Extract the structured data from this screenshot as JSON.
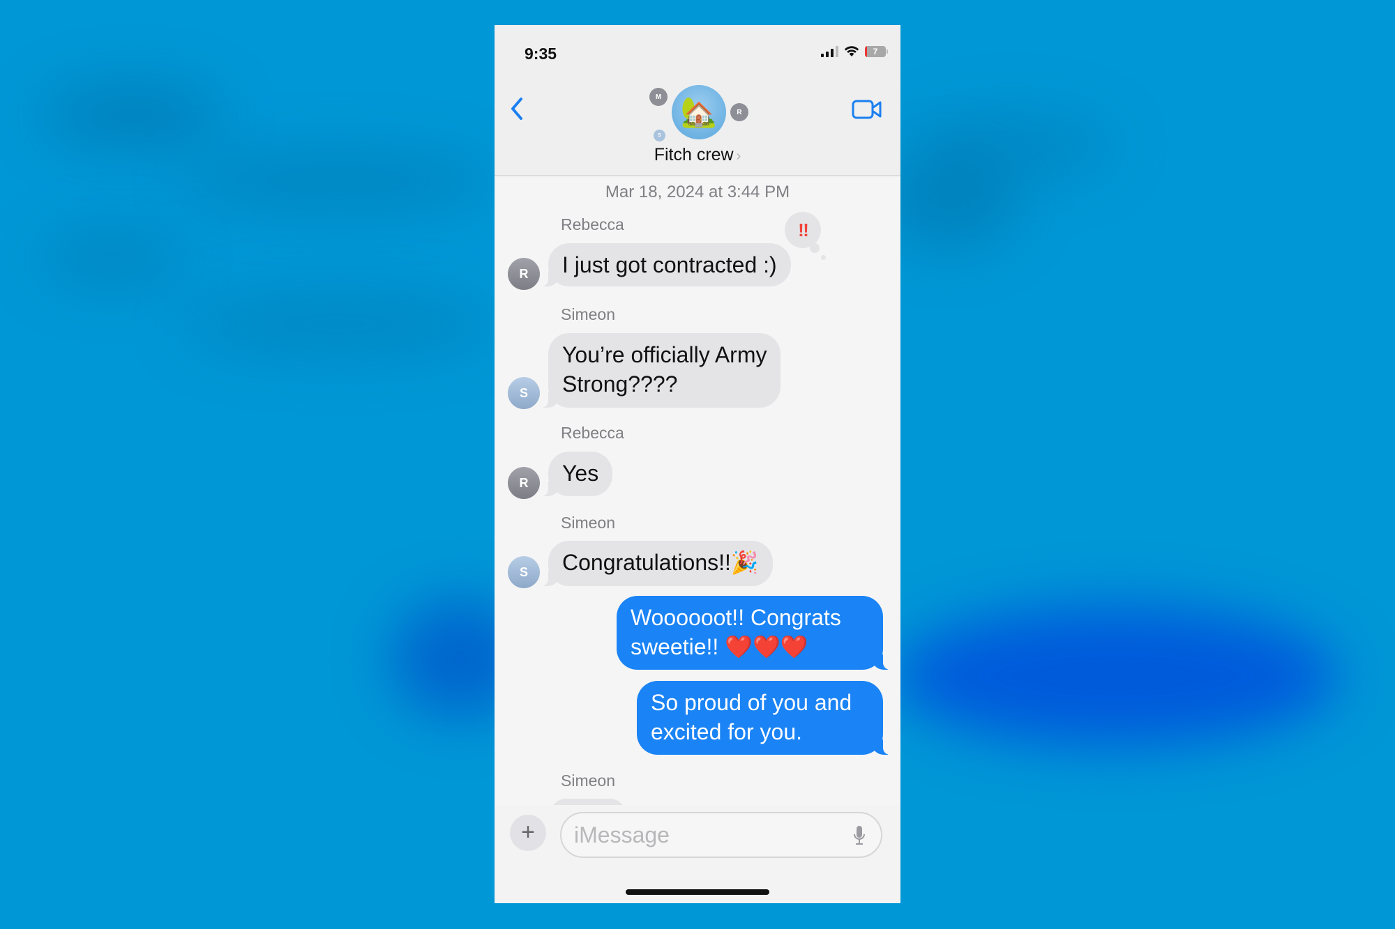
{
  "status_bar": {
    "time": "9:35",
    "signal_icon": "cellular-signal-icon",
    "wifi_icon": "wifi-icon",
    "battery_level": "7",
    "battery_icon": "battery-icon"
  },
  "header": {
    "back_icon": "chevron-left-icon",
    "group_name": "Fitch crew",
    "group_avatar_emoji": "🏡",
    "member_initials": [
      "M",
      "R",
      "S"
    ],
    "detail_chevron": "›",
    "video_icon": "video-camera-icon"
  },
  "conversation": {
    "timestamp": "Mar 18, 2024 at 3:44 PM",
    "messages": [
      {
        "sender": "Rebecca",
        "initial": "R",
        "direction": "incoming",
        "text": "I just got contracted :)",
        "reaction": "‼"
      },
      {
        "sender": "Simeon",
        "initial": "S",
        "direction": "incoming",
        "lines": [
          "You’re officially Army",
          "Strong????"
        ]
      },
      {
        "sender": "Rebecca",
        "initial": "R",
        "direction": "incoming",
        "text": "Yes"
      },
      {
        "sender": "Simeon",
        "initial": "S",
        "direction": "incoming",
        "text": "Congratulations!!🎉"
      },
      {
        "sender": "Me",
        "direction": "outgoing",
        "lines": [
          "Woooooot!!  Congrats",
          "sweetie!! ❤️❤️❤️"
        ]
      },
      {
        "sender": "Me",
        "direction": "outgoing",
        "lines": [
          "So proud of you and",
          "excited for you."
        ]
      },
      {
        "sender": "Simeon",
        "direction": "incoming",
        "text": ""
      }
    ]
  },
  "composer": {
    "plus_label": "+",
    "placeholder": "iMessage",
    "mic_icon": "microphone-icon"
  },
  "colors": {
    "accent": "#1a83f5",
    "incoming_bubble": "#e4e4e7",
    "background": "#0097d6"
  }
}
